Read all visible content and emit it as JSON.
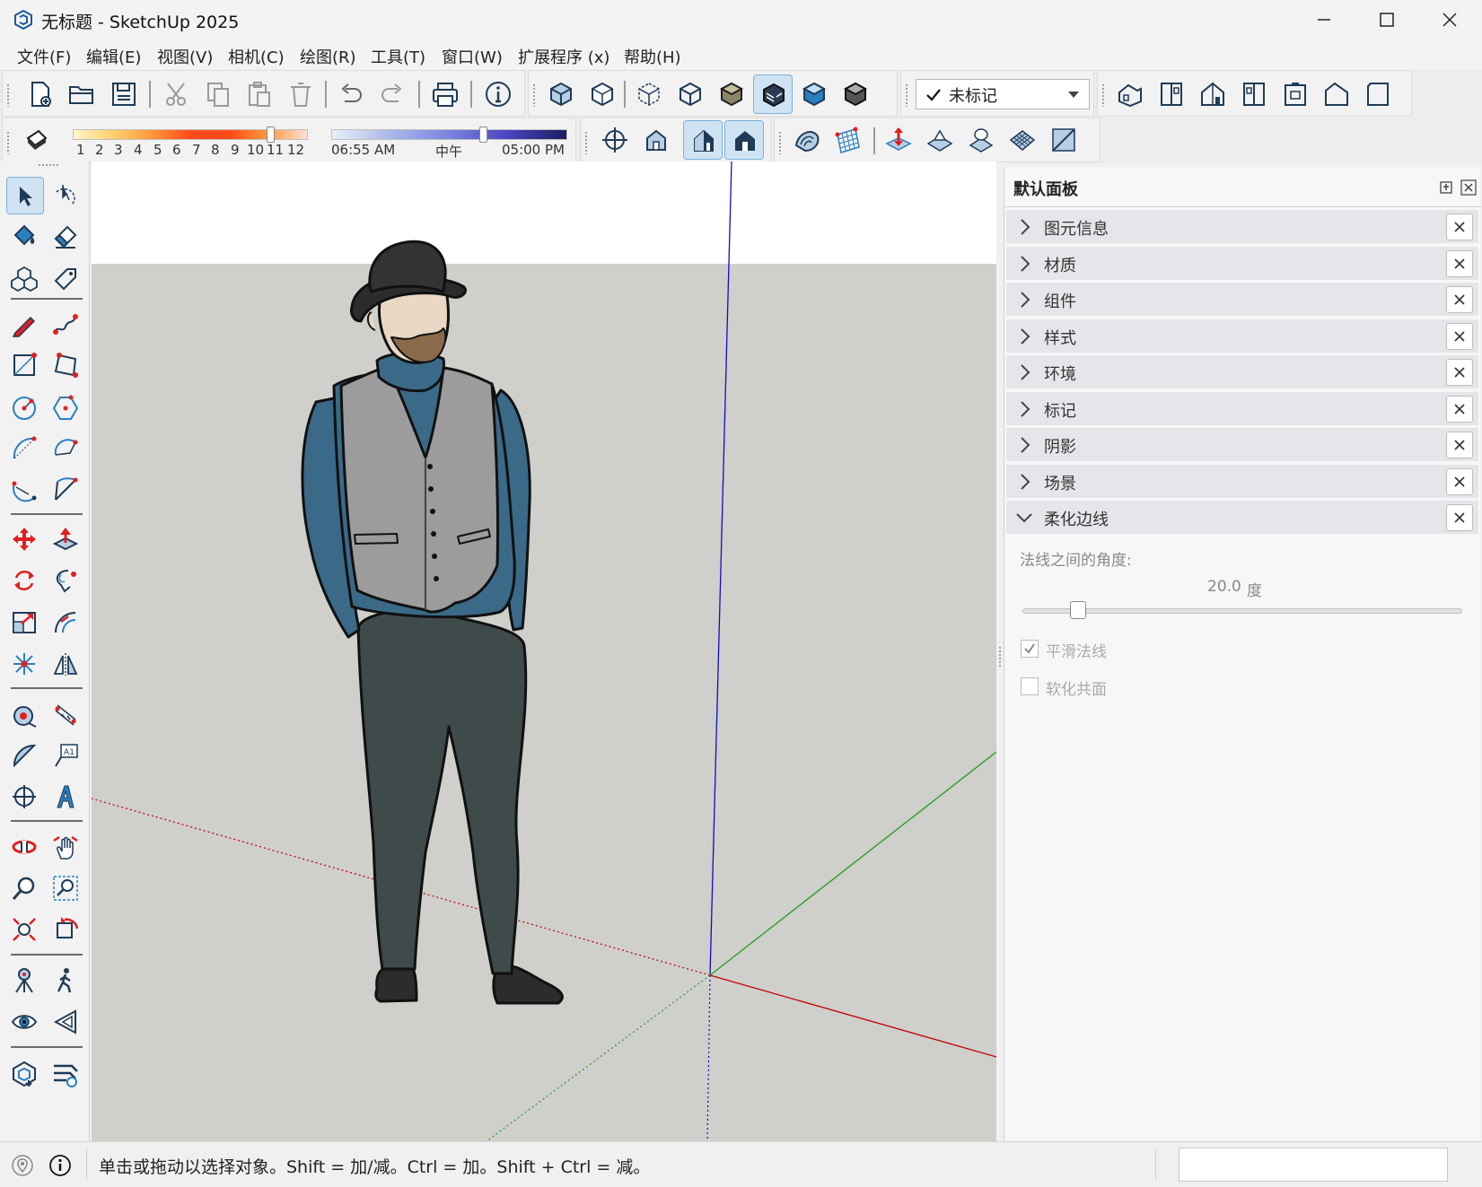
{
  "window": {
    "title": "无标题 - SketchUp 2025"
  },
  "menu": [
    "文件(F)",
    "编辑(E)",
    "视图(V)",
    "相机(C)",
    "绘图(R)",
    "工具(T)",
    "窗口(W)",
    "扩展程序 (x)",
    "帮助(H)"
  ],
  "toolbar": {
    "tag_select": "未标记",
    "months": [
      "1",
      "2",
      "3",
      "4",
      "5",
      "6",
      "7",
      "8",
      "9",
      "10",
      "11",
      "12"
    ],
    "time_start": "06:55 AM",
    "time_noon": "中午",
    "time_end": "05:00 PM"
  },
  "tray": {
    "title": "默认面板",
    "panels": [
      "图元信息",
      "材质",
      "组件",
      "样式",
      "环境",
      "标记",
      "阴影",
      "场景"
    ],
    "expanded_panel": "柔化边线",
    "soften": {
      "angle_label": "法线之间的角度:",
      "angle_value": "20.0",
      "angle_unit": "度",
      "angle_fraction": 0.11,
      "smooth_label": "平滑法线",
      "smooth_checked": true,
      "coplanar_label": "软化共面",
      "coplanar_checked": false
    }
  },
  "status": {
    "hint": "单击或拖动以选择对象。Shift = 加/减。Ctrl = 加。Shift + Ctrl = 减。"
  },
  "colors": {
    "accent": "#2e73b5",
    "axis_red": "#c00000",
    "axis_green": "#20a020",
    "axis_blue": "#1010c0",
    "ground": "#cfcfcb"
  }
}
